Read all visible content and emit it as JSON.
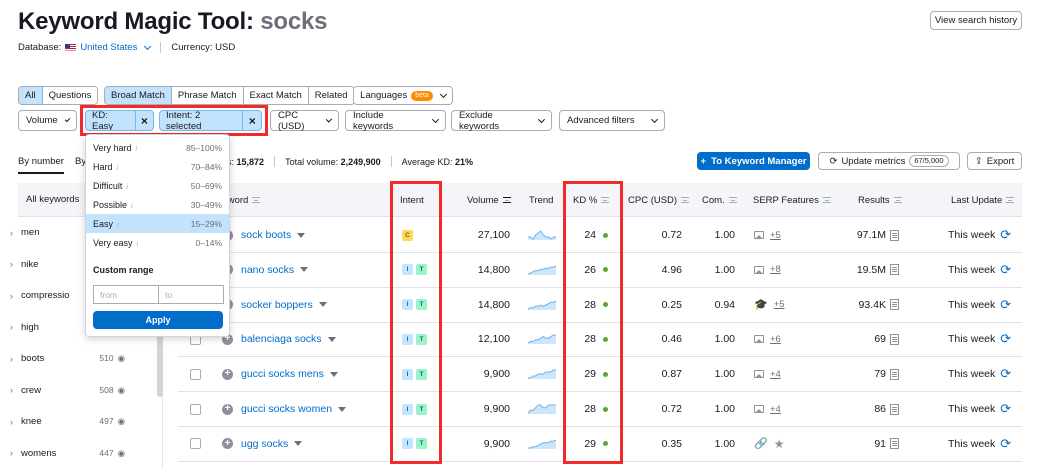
{
  "header": {
    "title": "Keyword Magic Tool:",
    "keyword": "socks",
    "database_label": "Database:",
    "database_value": "United States",
    "currency": "Currency: USD",
    "history_button": "View search history"
  },
  "tabs": {
    "all": "All",
    "questions": "Questions",
    "broad": "Broad Match",
    "phrase": "Phrase Match",
    "exact": "Exact Match",
    "related": "Related",
    "languages": "Languages",
    "beta": "beta"
  },
  "filters": {
    "volume": "Volume",
    "kd_chip": "KD: Easy",
    "intent_chip": "Intent: 2 selected",
    "cpc": "CPC (USD)",
    "include": "Include keywords",
    "exclude": "Exclude keywords",
    "advanced": "Advanced filters"
  },
  "kd_dropdown": {
    "items": [
      {
        "label": "Very hard",
        "range": "85–100%"
      },
      {
        "label": "Hard",
        "range": "70–84%"
      },
      {
        "label": "Difficult",
        "range": "50–69%"
      },
      {
        "label": "Possible",
        "range": "30–49%"
      },
      {
        "label": "Easy",
        "range": "15–29%"
      },
      {
        "label": "Very easy",
        "range": "0–14%"
      }
    ],
    "info": "i",
    "custom_range": "Custom range",
    "from_placeholder": "from",
    "to_placeholder": "to",
    "apply": "Apply"
  },
  "subtabs": {
    "by_number": "By number",
    "by_other": "By"
  },
  "stats": {
    "keywords_suffix": "s:",
    "keywords_value": "15,872",
    "total_volume_label": "Total volume:",
    "total_volume_value": "2,249,900",
    "avg_kd_label": "Average KD:",
    "avg_kd_value": "21%"
  },
  "actions": {
    "to_manager": "To Keyword Manager",
    "update": "Update metrics",
    "update_count": "67/5,000",
    "export": "Export"
  },
  "sidebar": {
    "header": "All keywords",
    "items": [
      {
        "label": "men",
        "count": ""
      },
      {
        "label": "nike",
        "count": ""
      },
      {
        "label": "compressio",
        "count": ""
      },
      {
        "label": "high",
        "count": ""
      },
      {
        "label": "boots",
        "count": "510"
      },
      {
        "label": "crew",
        "count": "508"
      },
      {
        "label": "knee",
        "count": "497"
      },
      {
        "label": "womens",
        "count": "447"
      }
    ]
  },
  "table": {
    "columns": {
      "keyword": "yword",
      "intent": "Intent",
      "volume": "Volume",
      "trend": "Trend",
      "kd": "KD %",
      "cpc": "CPC (USD)",
      "com": "Com.",
      "serp": "SERP Features",
      "results": "Results",
      "last_update": "Last Update"
    },
    "rows": [
      {
        "keyword": "sock boots",
        "intents": [
          "C"
        ],
        "volume": "27,100",
        "kd": "24",
        "cpc": "0.72",
        "com": "1.00",
        "serp_icon": "image-icon",
        "serp_more": "+5",
        "results": "97.1M",
        "updated": "This week",
        "trend": [
          6,
          6,
          5,
          7,
          8,
          9,
          7,
          6,
          6,
          5,
          6,
          6
        ]
      },
      {
        "keyword": "nano socks",
        "intents": [
          "I",
          "T"
        ],
        "volume": "14,800",
        "kd": "26",
        "cpc": "4.96",
        "com": "1.00",
        "serp_icon": "image-icon",
        "serp_more": "+8",
        "results": "19.5M",
        "updated": "This week",
        "trend": [
          3,
          4,
          5,
          6,
          6,
          7,
          7,
          8,
          8,
          9,
          9,
          10
        ]
      },
      {
        "keyword": "socker boppers",
        "intents": [
          "I",
          "T"
        ],
        "volume": "14,800",
        "kd": "28",
        "cpc": "0.25",
        "com": "0.94",
        "serp_icon": "graduation-cap-icon",
        "serp_more": "+5",
        "results": "93.4K",
        "updated": "This week",
        "trend": [
          4,
          5,
          5,
          6,
          6,
          7,
          6,
          7,
          8,
          9,
          9,
          10
        ]
      },
      {
        "keyword": "balenciaga socks",
        "intents": [
          "I",
          "T"
        ],
        "volume": "12,100",
        "kd": "28",
        "cpc": "0.46",
        "com": "1.00",
        "serp_icon": "image-icon",
        "serp_more": "+6",
        "results": "69",
        "updated": "This week",
        "trend": [
          5,
          6,
          6,
          7,
          7,
          8,
          9,
          8,
          8,
          9,
          10,
          10
        ]
      },
      {
        "keyword": "gucci socks mens",
        "intents": [
          "I",
          "T"
        ],
        "volume": "9,900",
        "kd": "29",
        "cpc": "0.87",
        "com": "1.00",
        "serp_icon": "image-icon",
        "serp_more": "+4",
        "results": "79",
        "updated": "This week",
        "trend": [
          5,
          5,
          6,
          6,
          7,
          7,
          7,
          8,
          8,
          8,
          9,
          9
        ]
      },
      {
        "keyword": "gucci socks women",
        "intents": [
          "I",
          "T"
        ],
        "volume": "9,900",
        "kd": "28",
        "cpc": "0.72",
        "com": "1.00",
        "serp_icon": "image-icon",
        "serp_more": "+4",
        "results": "86",
        "updated": "This week",
        "trend": [
          5,
          6,
          6,
          7,
          8,
          8,
          7,
          7,
          8,
          8,
          8,
          8
        ]
      },
      {
        "keyword": "ugg socks",
        "intents": [
          "I",
          "T"
        ],
        "volume": "9,900",
        "kd": "29",
        "cpc": "0.35",
        "com": "1.00",
        "serp_icon": "link-star-icon",
        "serp_more": "",
        "results": "91",
        "updated": "This week",
        "trend": [
          4,
          4,
          5,
          5,
          6,
          7,
          8,
          8,
          8,
          9,
          9,
          10
        ]
      }
    ]
  },
  "colors": {
    "accent": "#006dca",
    "highlight_border": "#f22a2a",
    "kd_easy_dot": "#59a733"
  }
}
